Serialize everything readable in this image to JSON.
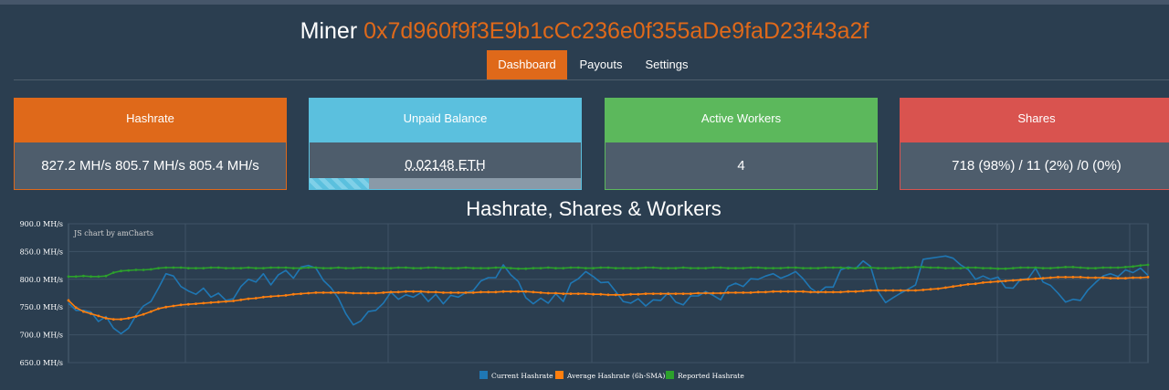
{
  "header": {
    "label": "Miner",
    "address": "0x7d960f9f3E9b1cCc236e0f355aDe9faD23f43a2f"
  },
  "tabs": [
    {
      "label": "Dashboard",
      "active": true
    },
    {
      "label": "Payouts",
      "active": false
    },
    {
      "label": "Settings",
      "active": false
    }
  ],
  "panels": {
    "hashrate": {
      "title": "Hashrate",
      "value": "827.2 MH/s  805.7 MH/s  805.4 MH/s",
      "color": "#df691a"
    },
    "balance": {
      "title": "Unpaid Balance",
      "value": "0.02148 ETH",
      "progress": 0.22,
      "color": "#5bc0de"
    },
    "workers": {
      "title": "Active Workers",
      "value": "4",
      "color": "#5cb85c"
    },
    "shares": {
      "title": "Shares",
      "value": "718 (98%) / 11 (2%) /0 (0%)",
      "color": "#d9534f"
    }
  },
  "chart_title": "Hashrate, Shares & Workers",
  "chart_data": {
    "type": "line",
    "credit": "JS chart by amCharts",
    "y_ticks": [
      "900.0 MH/s",
      "850.0 MH/s",
      "800.0 MH/s",
      "750.0 MH/s",
      "700.0 MH/s",
      "650.0 MH/s"
    ],
    "ylim": [
      650,
      900
    ],
    "grid": true,
    "legend_position": "bottom",
    "series": [
      {
        "name": "Current Hashrate",
        "color": "#1f77b4",
        "values": [
          757,
          744,
          744,
          741,
          724,
          733,
          712,
          702,
          712,
          735,
          752,
          760,
          784,
          810,
          806,
          787,
          779,
          773,
          784,
          768,
          775,
          762,
          765,
          787,
          800,
          795,
          810,
          790,
          808,
          816,
          802,
          822,
          825,
          820,
          798,
          785,
          766,
          738,
          718,
          725,
          742,
          744,
          757,
          777,
          764,
          772,
          768,
          776,
          760,
          773,
          756,
          771,
          768,
          776,
          780,
          797,
          803,
          803,
          826,
          808,
          796,
          767,
          756,
          766,
          757,
          774,
          760,
          793,
          801,
          814,
          805,
          794,
          795,
          778,
          760,
          757,
          765,
          752,
          763,
          762,
          776,
          759,
          754,
          770,
          770,
          778,
          771,
          763,
          787,
          793,
          787,
          801,
          800,
          806,
          810,
          802,
          807,
          814,
          801,
          784,
          775,
          786,
          786,
          817,
          822,
          819,
          833,
          823,
          778,
          758,
          767,
          775,
          782,
          790,
          836,
          838,
          840,
          842,
          838,
          826,
          818,
          800,
          806,
          800,
          804,
          785,
          784,
          800,
          801,
          820,
          795,
          789,
          775,
          759,
          764,
          762,
          781,
          794,
          806,
          810,
          805,
          817,
          812,
          820,
          807
        ]
      },
      {
        "name": "Average Hashrate (6h-SMA)",
        "color": "#ff7f0e",
        "values": [
          762,
          749,
          742,
          738,
          734,
          730,
          728,
          728,
          730,
          733,
          737,
          742,
          747,
          750,
          752,
          754,
          755,
          756,
          757,
          758,
          759,
          760,
          761,
          763,
          765,
          766,
          768,
          769,
          770,
          771,
          773,
          774,
          775,
          776,
          776,
          776,
          776,
          776,
          775,
          775,
          775,
          775,
          776,
          777,
          777,
          778,
          778,
          778,
          777,
          777,
          776,
          776,
          776,
          776,
          776,
          777,
          777,
          777,
          778,
          778,
          778,
          778,
          777,
          776,
          775,
          775,
          774,
          774,
          774,
          774,
          773,
          773,
          772,
          772,
          772,
          773,
          773,
          774,
          774,
          774,
          774,
          774,
          774,
          774,
          775,
          775,
          775,
          775,
          776,
          776,
          776,
          776,
          777,
          777,
          778,
          778,
          778,
          778,
          778,
          777,
          777,
          777,
          777,
          777,
          778,
          778,
          779,
          780,
          780,
          780,
          780,
          780,
          780,
          780,
          781,
          782,
          783,
          785,
          787,
          789,
          791,
          792,
          794,
          795,
          796,
          797,
          798,
          799,
          800,
          801,
          802,
          803,
          804,
          804,
          804,
          804,
          803,
          803,
          803,
          802,
          802,
          802,
          803,
          803,
          804
        ]
      },
      {
        "name": "Reported Hashrate",
        "color": "#2ca02c",
        "values": [
          805,
          805,
          806,
          805,
          805,
          806,
          812,
          815,
          816,
          817,
          817,
          818,
          820,
          821,
          821,
          821,
          820,
          820,
          820,
          821,
          821,
          820,
          820,
          820,
          821,
          820,
          820,
          821,
          821,
          821,
          820,
          820,
          821,
          821,
          820,
          820,
          821,
          820,
          820,
          821,
          821,
          820,
          820,
          820,
          821,
          821,
          820,
          820,
          821,
          821,
          820,
          820,
          820,
          821,
          820,
          820,
          820,
          821,
          821,
          820,
          819,
          819,
          820,
          820,
          821,
          820,
          820,
          821,
          821,
          820,
          820,
          821,
          821,
          820,
          820,
          820,
          820,
          821,
          821,
          820,
          820,
          820,
          821,
          820,
          820,
          820,
          821,
          821,
          820,
          820,
          820,
          821,
          821,
          820,
          820,
          820,
          821,
          821,
          820,
          820,
          820,
          821,
          821,
          821,
          820,
          820,
          821,
          821,
          820,
          820,
          820,
          821,
          821,
          822,
          822,
          821,
          821,
          820,
          820,
          820,
          821,
          821,
          820,
          820,
          819,
          819,
          820,
          821,
          821,
          821,
          820,
          820,
          821,
          822,
          822,
          821,
          820,
          820,
          821,
          821,
          821,
          822,
          823,
          825,
          826
        ]
      }
    ]
  }
}
